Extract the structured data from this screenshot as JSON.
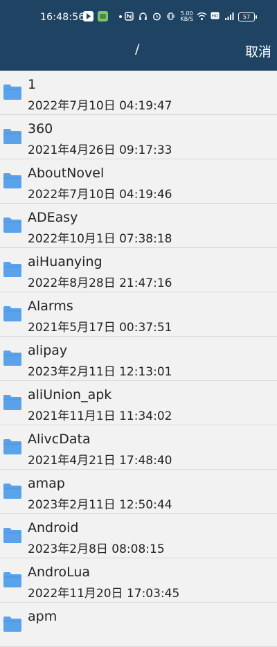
{
  "status_bar": {
    "time": "16:48:56",
    "net_speed_value": "5.00",
    "net_speed_unit": "KB/S",
    "battery": "57"
  },
  "header": {
    "title": "/",
    "cancel_label": "取消"
  },
  "colors": {
    "header_bg": "#1f4463",
    "folder": "#5aa3ea",
    "list_bg": "#f2f2f2"
  },
  "icons": {
    "folder": "folder-icon"
  },
  "files": [
    {
      "name": "1",
      "date": "2022年7月10日 04:19:47"
    },
    {
      "name": "360",
      "date": "2021年4月26日 09:17:33"
    },
    {
      "name": "AboutNovel",
      "date": "2022年7月10日 04:19:46"
    },
    {
      "name": "ADEasy",
      "date": "2022年10月1日 07:38:18"
    },
    {
      "name": "aiHuanying",
      "date": "2022年8月28日 21:47:16"
    },
    {
      "name": "Alarms",
      "date": "2021年5月17日 00:37:51"
    },
    {
      "name": "alipay",
      "date": "2023年2月11日 12:13:01"
    },
    {
      "name": "aliUnion_apk",
      "date": "2021年11月1日 11:34:02"
    },
    {
      "name": "AlivcData",
      "date": "2021年4月21日 17:48:40"
    },
    {
      "name": "amap",
      "date": "2023年2月11日 12:50:44"
    },
    {
      "name": "Android",
      "date": "2023年2月8日 08:08:15"
    },
    {
      "name": "AndroLua",
      "date": "2022年11月20日 17:03:45"
    },
    {
      "name": "apm",
      "date": ""
    }
  ]
}
